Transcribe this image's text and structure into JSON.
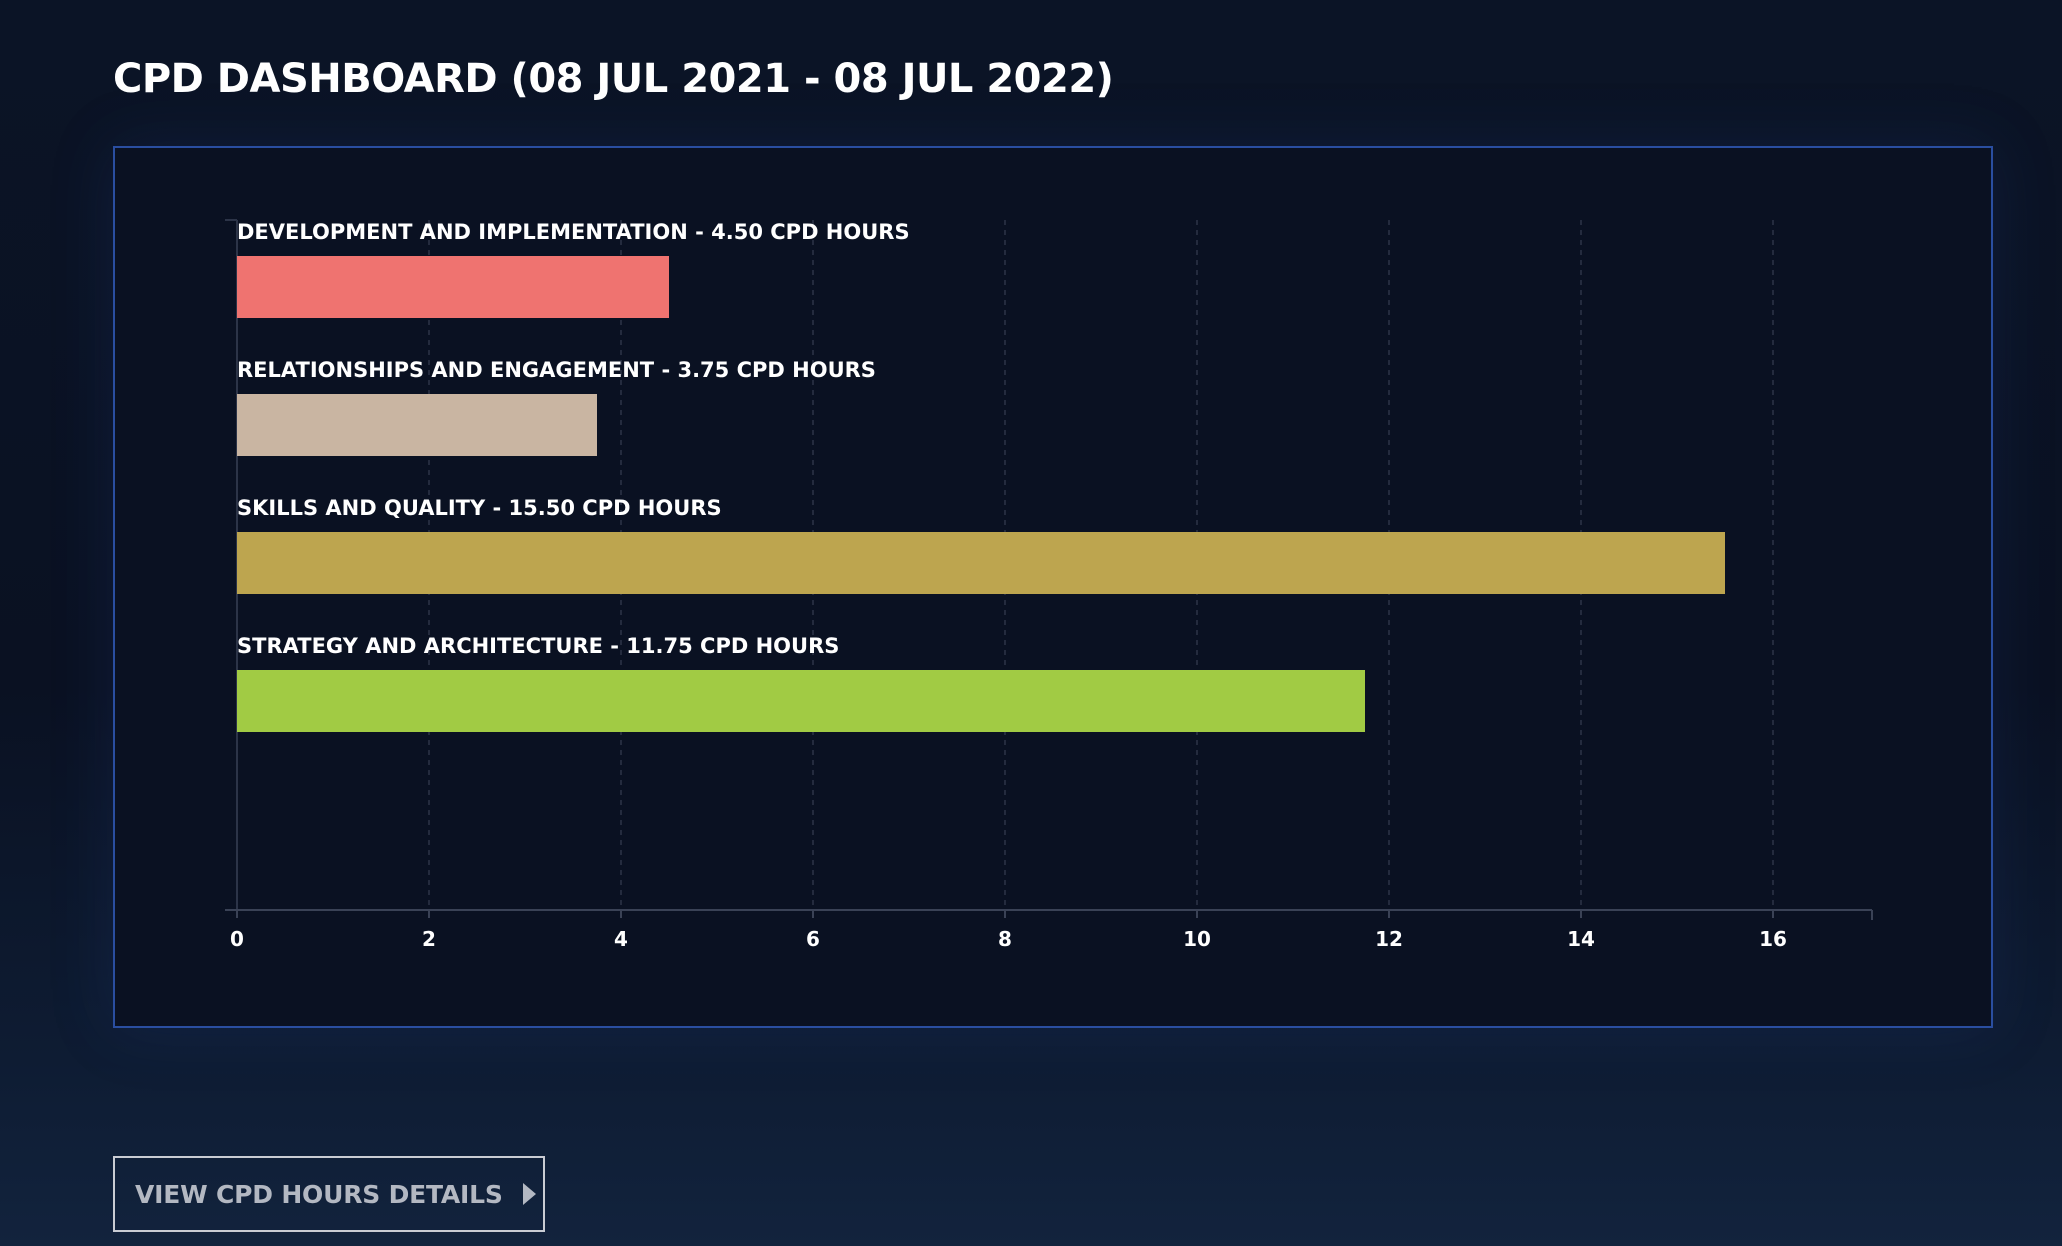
{
  "page": {
    "title": "CPD DASHBOARD (08 JUL 2021 - 08 JUL 2022)"
  },
  "chart_data": {
    "type": "bar",
    "orientation": "horizontal",
    "categories": [
      "DEVELOPMENT AND IMPLEMENTATION - 4.50 CPD HOURS",
      "RELATIONSHIPS AND ENGAGEMENT - 3.75 CPD HOURS",
      "SKILLS AND QUALITY - 15.50 CPD HOURS",
      "STRATEGY AND ARCHITECTURE - 11.75 CPD HOURS"
    ],
    "values": [
      4.5,
      3.75,
      15.5,
      11.75
    ],
    "colors": [
      "#ef7370",
      "#c9b5a2",
      "#bda54f",
      "#a1cb44"
    ],
    "xlim": [
      0,
      17
    ],
    "x_ticks": [
      "0",
      "2",
      "4",
      "6",
      "8",
      "10",
      "12",
      "14",
      "16"
    ],
    "grid": true,
    "legend": "none"
  },
  "actions": {
    "view_details_label": "VIEW CPD HOURS DETAILS"
  }
}
